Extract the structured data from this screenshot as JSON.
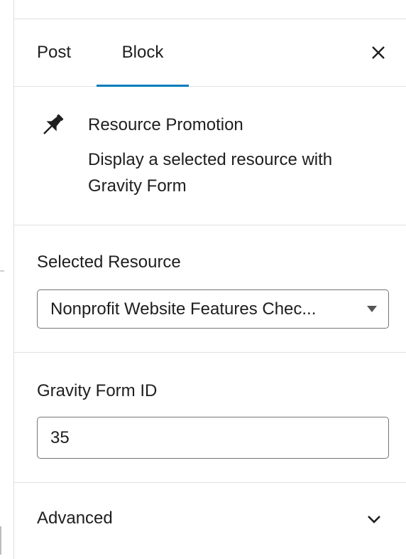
{
  "tabs": {
    "post_label": "Post",
    "block_label": "Block",
    "active": "Block",
    "accent_color": "#007cba"
  },
  "block": {
    "icon": "pin-icon",
    "title": "Resource Promotion",
    "description": "Display a selected resource with Gravity Form"
  },
  "resource": {
    "label": "Selected Resource",
    "selected_value": "Nonprofit Website Features Chec..."
  },
  "gravity": {
    "label": "Gravity Form ID",
    "value": "35"
  },
  "advanced": {
    "label": "Advanced",
    "icon": "chevron-down-icon"
  },
  "close": {
    "icon": "close-icon"
  }
}
